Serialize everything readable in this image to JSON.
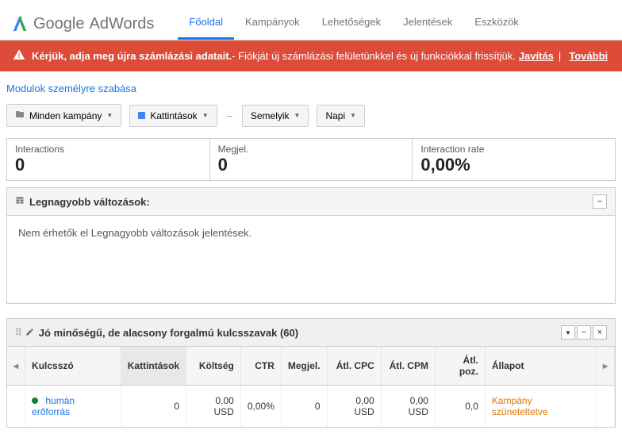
{
  "header": {
    "logo1": "Google",
    "logo2": "AdWords",
    "nav": [
      "Főoldal",
      "Kampányok",
      "Lehetőségek",
      "Jelentések",
      "Eszközök"
    ]
  },
  "alert": {
    "bold": "Kérjük, adja meg újra számlázási adatait.",
    "text": " - Fiókját új számlázási felületünkkel és új funkciókkal frissítjük. ",
    "fix": "Javítás",
    "more": "További"
  },
  "customize": "Modulok személyre szabása",
  "toolbar": {
    "campaigns": "Minden kampány",
    "metric1": "Kattintások",
    "metric2": "Semelyik",
    "period": "Napi"
  },
  "stats": [
    {
      "label": "Interactions",
      "value": "0"
    },
    {
      "label": "Megjel.",
      "value": "0"
    },
    {
      "label": "Interaction rate",
      "value": "0,00%"
    }
  ],
  "panel1": {
    "title": "Legnagyobb változások:",
    "body": "Nem érhetők el Legnagyobb változások jelentések."
  },
  "panel2": {
    "title": "Jó minőségű, de alacsony forgalmú kulcsszavak (60)",
    "cols": [
      "Kulcsszó",
      "Kattintások",
      "Költség",
      "CTR",
      "Megjel.",
      "Átl. CPC",
      "Átl. CPM",
      "Átl. poz.",
      "Állapot"
    ],
    "row": {
      "keyword": "humán erőforrás",
      "clicks": "0",
      "cost": "0,00 USD",
      "ctr": "0,00%",
      "impr": "0",
      "cpc": "0,00 USD",
      "cpm": "0,00 USD",
      "pos": "0,0",
      "status": "Kampány szüneteltetve"
    }
  }
}
